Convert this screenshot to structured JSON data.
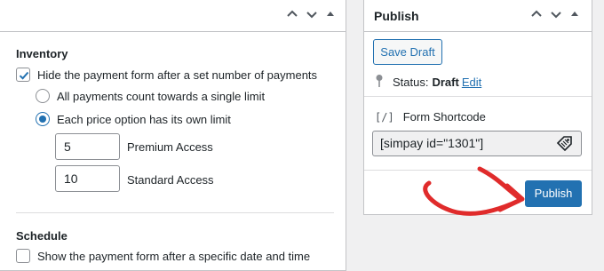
{
  "inventory": {
    "title": "Inventory",
    "hide_form_label": "Hide the payment form after a set number of payments",
    "hide_form_checked": true,
    "option_single": "All payments count towards a single limit",
    "option_each": "Each price option has its own limit",
    "selected_option": "each",
    "limits": [
      {
        "value": "5",
        "label": "Premium Access"
      },
      {
        "value": "10",
        "label": "Standard Access"
      }
    ]
  },
  "schedule": {
    "title": "Schedule",
    "show_form_label": "Show the payment form after a specific date and time",
    "show_form_checked": false
  },
  "publish": {
    "title": "Publish",
    "save_draft_label": "Save Draft",
    "status_prefix": "Status:",
    "status_value": "Draft",
    "edit_link": "Edit",
    "shortcode_bracket": "[/]",
    "shortcode_label": "Form Shortcode",
    "shortcode_value": "[simpay id=\"1301\"]",
    "publish_label": "Publish"
  },
  "colors": {
    "accent": "#2271b1",
    "annotation_arrow": "#e02b2b"
  },
  "icons": {
    "header": [
      "chevron-up-icon",
      "chevron-down-icon",
      "triangle-up-icon"
    ],
    "status": "pin-icon",
    "shortcode_copy": "tag-icon"
  }
}
